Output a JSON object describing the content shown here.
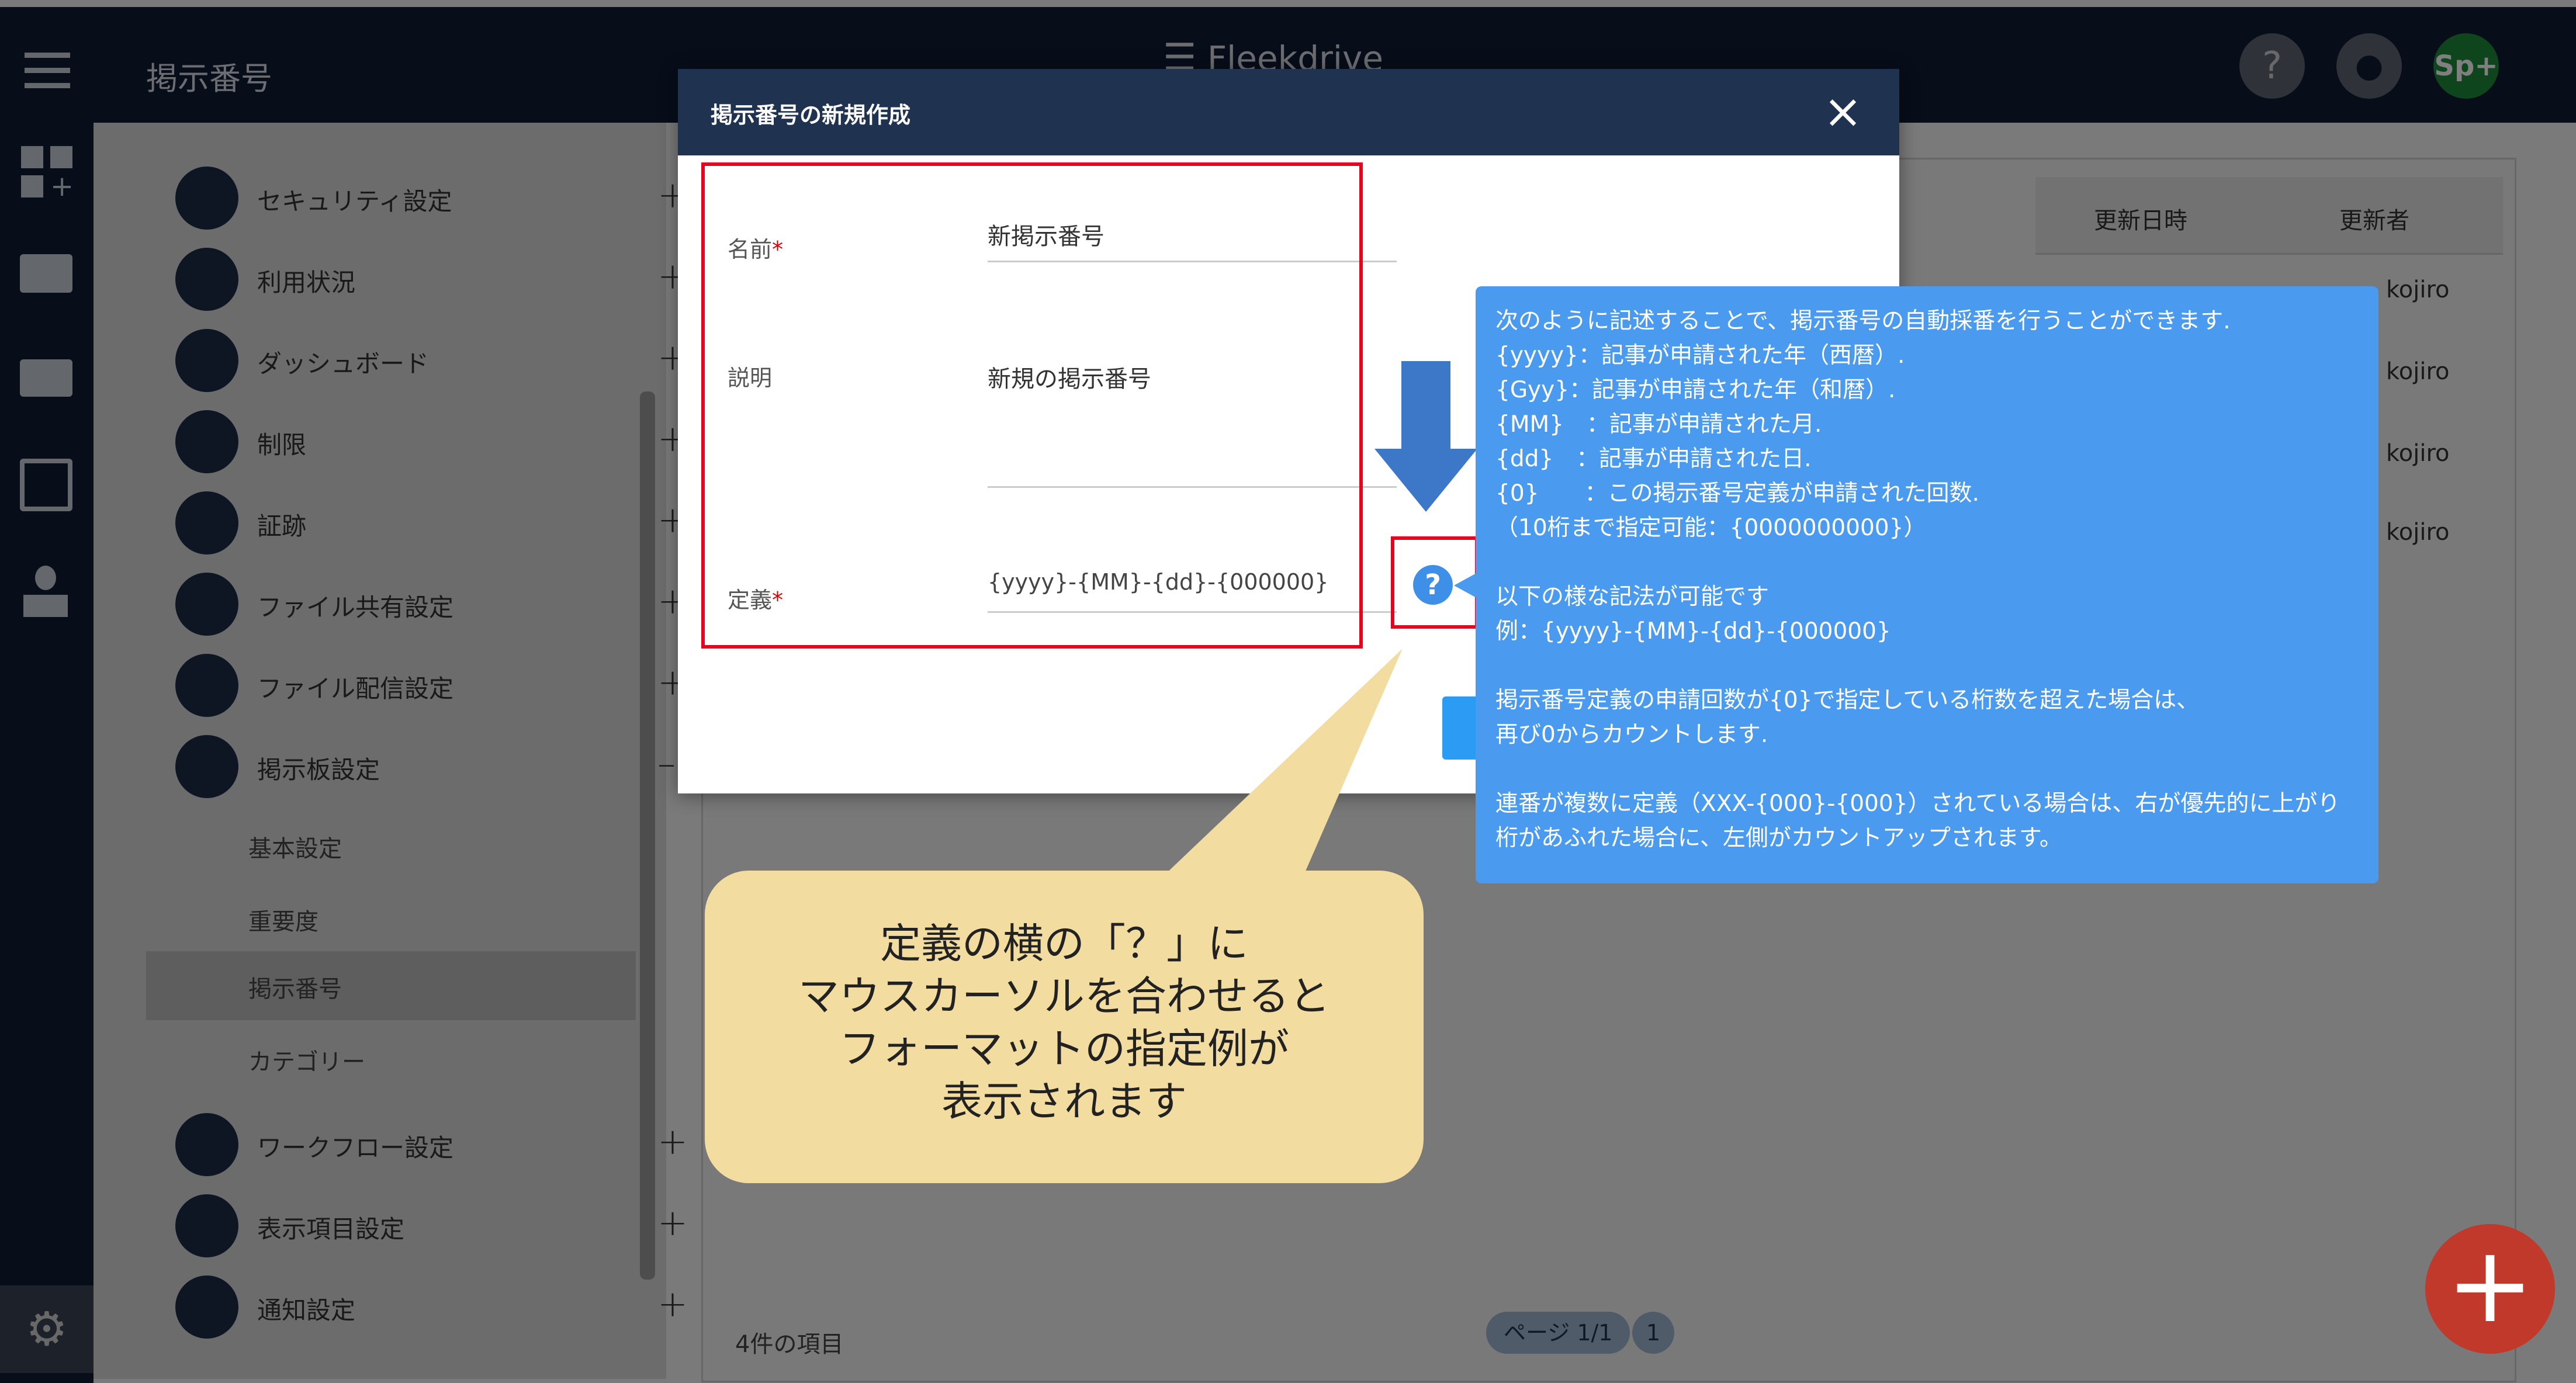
{
  "header": {
    "page_title": "掲示番号",
    "brand": "Fleekdrive",
    "user_badge": "Sp+"
  },
  "sidebar": {
    "items": [
      {
        "label": "セキュリティ設定",
        "icon": "shield-icon",
        "toggle": "+"
      },
      {
        "label": "利用状況",
        "icon": "chart-icon",
        "toggle": "+"
      },
      {
        "label": "ダッシュボード",
        "icon": "dashboard-icon",
        "toggle": "+"
      },
      {
        "label": "制限",
        "icon": "camera-icon",
        "toggle": "+"
      },
      {
        "label": "証跡",
        "icon": "clock-icon",
        "toggle": "+"
      },
      {
        "label": "ファイル共有設定",
        "icon": "share-icon",
        "toggle": "+"
      },
      {
        "label": "ファイル配信設定",
        "icon": "mail-icon",
        "toggle": "+"
      },
      {
        "label": "掲示板設定",
        "icon": "calendar-icon",
        "toggle": "–"
      },
      {
        "label": "ワークフロー設定",
        "icon": "stamp-icon",
        "toggle": "+"
      },
      {
        "label": "表示項目設定",
        "icon": "list-icon",
        "toggle": "+"
      },
      {
        "label": "通知設定",
        "icon": "bell-icon",
        "toggle": "+"
      }
    ],
    "subitems": [
      "基本設定",
      "重要度",
      "掲示番号",
      "カテゴリー"
    ]
  },
  "table": {
    "headers": [
      "更新日時",
      "更新者"
    ],
    "users": [
      "kojiro",
      "kojiro",
      "kojiro",
      "kojiro"
    ],
    "footer": "4件の項目",
    "page": "ページ 1/1",
    "page_num": "1"
  },
  "modal": {
    "title": "掲示番号の新規作成",
    "name_label": "名前",
    "name_value": "新掲示番号",
    "desc_label": "説明",
    "desc_value": "新規の掲示番号",
    "def_label": "定義",
    "def_value": "{yyyy}-{MM}-{dd}-{000000}",
    "required": "*"
  },
  "tooltip": {
    "lines": [
      "次のように記述することで、掲示番号の自動採番を行うことができます.",
      "{yyyy}：記事が申請された年（西暦）.",
      "{Gyy}：記事が申請された年（和暦）.",
      "{MM}　：記事が申請された月.",
      "{dd}　：記事が申請された日.",
      "{0}　　：この掲示番号定義が申請された回数.",
      "（10桁まで指定可能：{0000000000}）",
      "",
      "以下の様な記法が可能です",
      "例：{yyyy}-{MM}-{dd}-{000000}",
      "",
      "掲示番号定義の申請回数が{0}で指定している桁数を超えた場合は、",
      "再び0からカウントします.",
      "",
      "連番が複数に定義（XXX-{000}-{000}）されている場合は、右が優先的に上がり",
      "桁があふれた場合に、左側がカウントアップされます。"
    ]
  },
  "callout": {
    "lines": [
      "定義の横の「？」に",
      "マウスカーソルを合わせると",
      "フォーマットの指定例が",
      "表示されます"
    ]
  },
  "colors": {
    "navy": "#0e1b33",
    "modal_header": "#1f3350",
    "tooltip": "#4a9af0",
    "callout": "#f2dc9f",
    "highlight": "#e8001c",
    "arrow": "#3d78c8",
    "fab": "#c0392b"
  }
}
